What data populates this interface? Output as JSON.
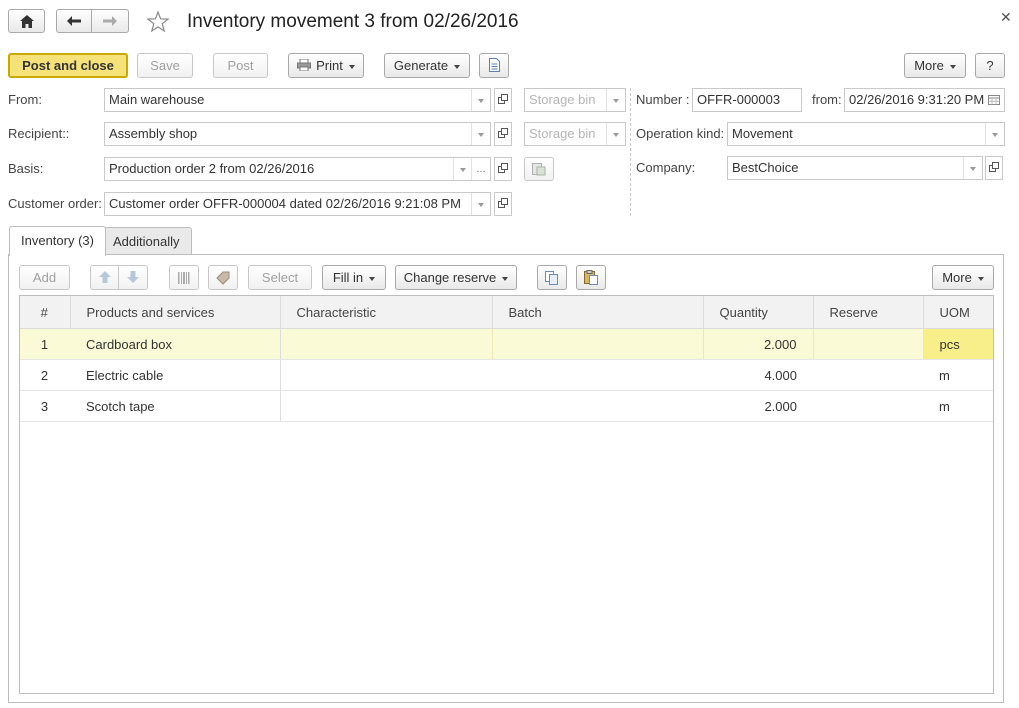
{
  "header": {
    "title": "Inventory movement 3 from 02/26/2016",
    "home_icon": "home-icon",
    "back_icon": "arrow-left-icon",
    "forward_icon": "arrow-right-icon",
    "favorite_icon": "star-icon",
    "close_icon": "close-icon"
  },
  "toolbar": {
    "post_and_close": "Post and close",
    "save": "Save",
    "post": "Post",
    "print": "Print",
    "generate": "Generate",
    "more": "More",
    "help": "?"
  },
  "form": {
    "from_label": "From:",
    "from_value": "Main warehouse",
    "from_storage_placeholder": "Storage bin",
    "recipient_label": "Recipient::",
    "recipient_value": "Assembly shop",
    "recipient_storage_placeholder": "Storage bin",
    "basis_label": "Basis:",
    "basis_value": "Production order 2 from 02/26/2016",
    "customer_order_label": "Customer order:",
    "customer_order_value": "Customer order OFFR-000004 dated 02/26/2016 9:21:08 PM",
    "number_label": "Number :",
    "number_value": "OFFR-000003",
    "from_date_label": "from:",
    "from_date_value": "02/26/2016  9:31:20 PM",
    "operation_kind_label": "Operation kind:",
    "operation_kind_value": "Movement",
    "company_label": "Company:",
    "company_value": "BestChoice"
  },
  "tabs": [
    {
      "label": "Inventory (3)"
    },
    {
      "label": "Additionally"
    }
  ],
  "table_toolbar": {
    "add": "Add",
    "select": "Select",
    "fill_in": "Fill in",
    "change_reserve": "Change reserve",
    "more": "More"
  },
  "table": {
    "columns": [
      "#",
      "Products and services",
      "Characteristic",
      "Batch",
      "Quantity",
      "Reserve",
      "UOM"
    ],
    "rows": [
      {
        "n": "1",
        "product": "Cardboard box",
        "characteristic": "",
        "batch": "",
        "quantity": "2.000",
        "reserve": "",
        "uom": "pcs"
      },
      {
        "n": "2",
        "product": "Electric cable",
        "characteristic": "",
        "batch": "",
        "quantity": "4.000",
        "reserve": "",
        "uom": "m"
      },
      {
        "n": "3",
        "product": "Scotch tape",
        "characteristic": "",
        "batch": "",
        "quantity": "2.000",
        "reserve": "",
        "uom": "m"
      }
    ]
  },
  "colors": {
    "primary_button": "#f5e37a",
    "selected_row": "#fbfad7",
    "selected_cell": "#f8ef8a"
  }
}
